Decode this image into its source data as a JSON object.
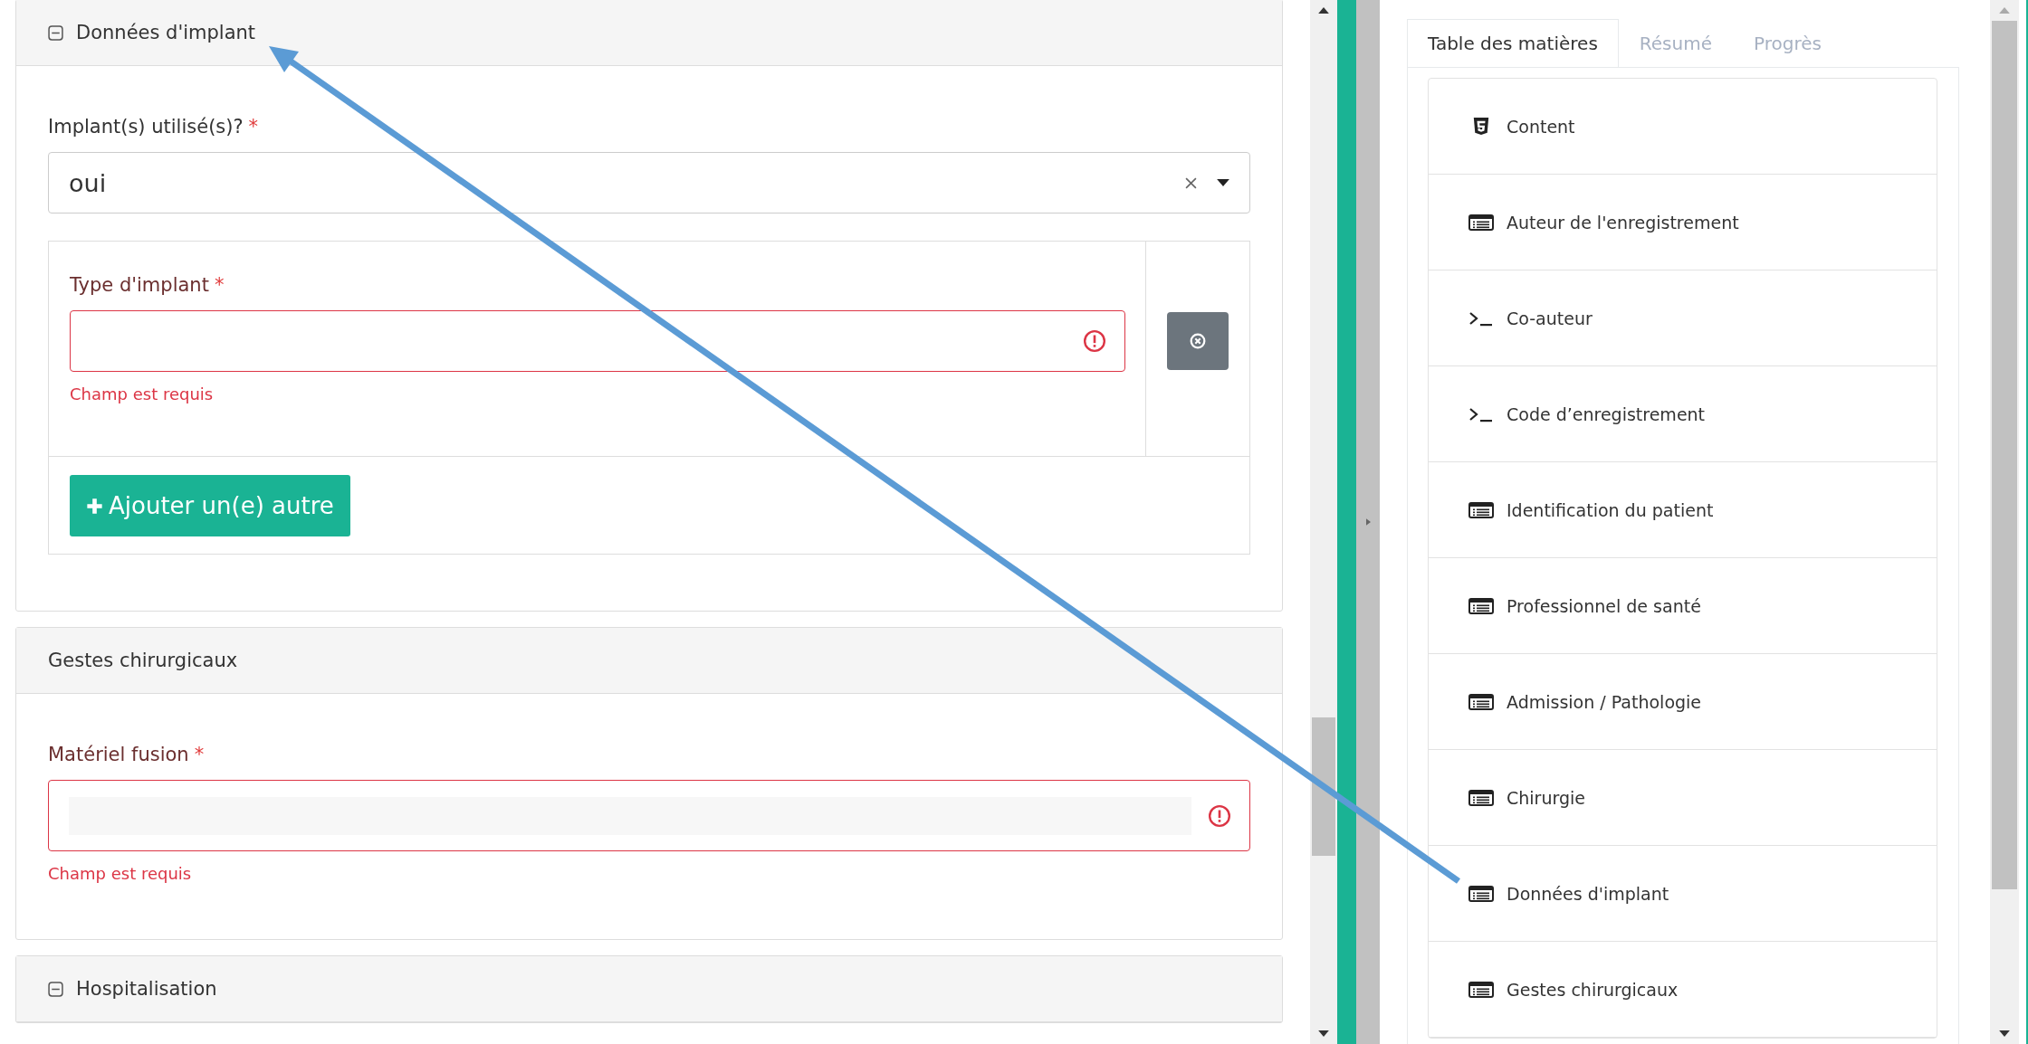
{
  "sections": [
    {
      "title": "Données d'implant",
      "collapsible": true,
      "fields": [
        {
          "kind": "select",
          "label": "Implant(s) utilisé(s)?",
          "required_mark": "*",
          "value": "oui"
        },
        {
          "kind": "repeater",
          "fields": [
            {
              "kind": "text",
              "label": "Type d'implant",
              "required_mark": "*",
              "error": "Champ est requis"
            }
          ],
          "add_button": "Ajouter un(e) autre"
        }
      ]
    },
    {
      "title": "Gestes chirurgicaux",
      "collapsible": false,
      "fields": [
        {
          "kind": "text",
          "label": "Matériel fusion",
          "required_mark": "*",
          "error": "Champ est requis"
        }
      ]
    },
    {
      "title": "Hospitalisation",
      "collapsible": true
    }
  ],
  "tabs": [
    {
      "label": "Table des matières",
      "selected": true
    },
    {
      "label": "Résumé",
      "selected": false
    },
    {
      "label": "Progrès",
      "selected": false
    }
  ],
  "toc": [
    {
      "label": "Content",
      "kind": "html"
    },
    {
      "label": "Auteur de l'enregistrement",
      "kind": "form"
    },
    {
      "label": "Co-auteur",
      "kind": "terminal"
    },
    {
      "label": "Code d’enregistrement",
      "kind": "terminal"
    },
    {
      "label": "Identification du patient",
      "kind": "form"
    },
    {
      "label": "Professionnel de santé",
      "kind": "form"
    },
    {
      "label": "Admission / Pathologie",
      "kind": "form"
    },
    {
      "label": "Chirurgie",
      "kind": "form"
    },
    {
      "label": "Données d'implant",
      "kind": "form"
    },
    {
      "label": "Gestes chirurgicaux",
      "kind": "form"
    }
  ]
}
